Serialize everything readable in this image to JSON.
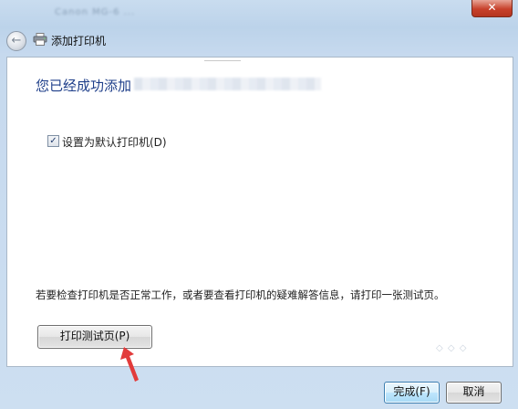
{
  "window": {
    "title": "Canon MG-6 ...",
    "close_label": "✕"
  },
  "nav": {
    "back_icon": "back-arrow-icon",
    "printer_icon": "printer-icon",
    "heading": "添加打印机"
  },
  "main": {
    "success_message": "您已经成功添加",
    "default_checkbox": {
      "checked": true,
      "label": "设置为默认打印机(D)"
    },
    "info_text": "若要检查打印机是否正常工作，或者要查看打印机的疑难解答信息，请打印一张测试页。",
    "test_page_button": "打印测试页(P)"
  },
  "footer": {
    "finish_button": "完成(F)",
    "cancel_button": "取消"
  },
  "colors": {
    "heading_blue": "#1f3f8a",
    "arrow_red": "#e23b3b"
  }
}
